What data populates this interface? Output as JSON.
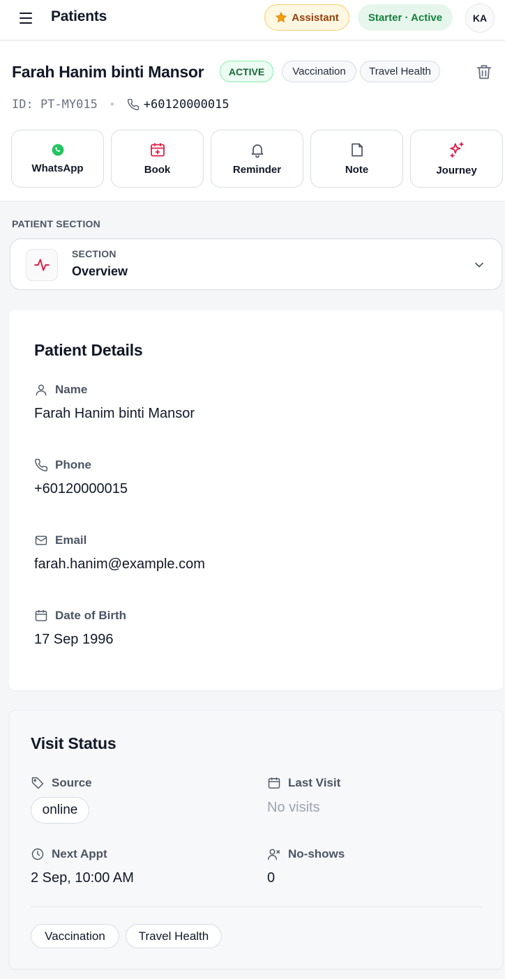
{
  "topbar": {
    "title": "Patients",
    "assistant_label": "Assistant",
    "plan_status": "Starter · Active",
    "avatar_initials": "KA"
  },
  "patient": {
    "name": "Farah Hanim binti Mansor",
    "status": "ACTIVE",
    "tags": [
      "Vaccination",
      "Travel Health"
    ],
    "id": "ID: PT-MY015",
    "phone": "+60120000015"
  },
  "actions": [
    "WhatsApp",
    "Book",
    "Reminder",
    "Note",
    "Journey"
  ],
  "section": {
    "heading": "PATIENT SECTION",
    "caption": "SECTION",
    "selected": "Overview"
  },
  "details": {
    "title": "Patient Details",
    "name_label": "Name",
    "name_value": "Farah Hanim binti Mansor",
    "phone_label": "Phone",
    "phone_value": "+60120000015",
    "email_label": "Email",
    "email_value": "farah.hanim@example.com",
    "dob_label": "Date of Birth",
    "dob_value": "17 Sep 1996"
  },
  "visit": {
    "title": "Visit Status",
    "source_label": "Source",
    "source_value": "online",
    "last_visit_label": "Last Visit",
    "last_visit_value": "No visits",
    "next_appt_label": "Next Appt",
    "next_appt_value": "2 Sep, 10:00 AM",
    "noshows_label": "No-shows",
    "noshows_value": "0",
    "tags": [
      "Vaccination",
      "Travel Health"
    ]
  },
  "colors": {
    "accent_red": "#e11d48",
    "whatsapp_green": "#22c55e",
    "active_green": "#166534",
    "assistant_amber": "#92400e"
  }
}
